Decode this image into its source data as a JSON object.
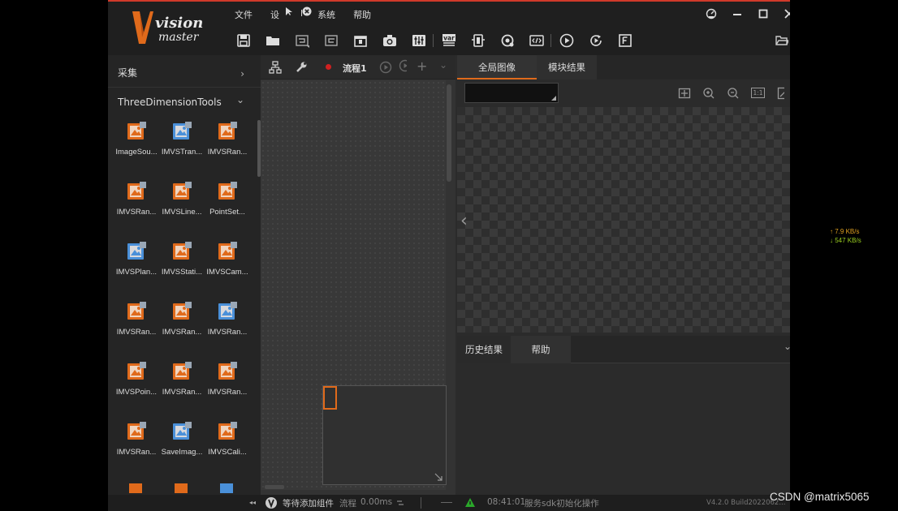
{
  "app": {
    "logo_word1": "vision",
    "logo_word2": "master",
    "brand_color": "#e06a1b",
    "accent_red": "#d03a2a"
  },
  "menu": [
    "文件",
    "设",
    "l",
    "系统",
    "帮助"
  ],
  "menu_icons": [
    "cursor-icon",
    "close-circle-icon"
  ],
  "window_controls": [
    "feedback-icon",
    "minimize-icon",
    "maximize-icon",
    "close-icon"
  ],
  "toolbar": [
    "save-icon",
    "open-folder-icon",
    "undo-icon",
    "redo-icon",
    "lock-icon",
    "camera-icon",
    "controller-settings-icon",
    "variable-icon",
    "device-icon",
    "communication-icon",
    "script-icon",
    "run-once-icon",
    "run-loop-icon",
    "format-icon"
  ],
  "left_panel": {
    "collect_label": "采集",
    "collect_arrow": "›",
    "group_label": "ThreeDimensionTools",
    "group_arrow": "⌄",
    "tools": [
      "ImageSou...",
      "IMVSTran...",
      "IMVSRan...",
      "IMVSRan...",
      "IMVSLine...",
      "PointSet...",
      "IMVSPlan...",
      "IMVSStati...",
      "IMVSCam...",
      "IMVSRan...",
      "IMVSRan...",
      "IMVSRan...",
      "IMVSPoin...",
      "IMVSRan...",
      "IMVSRan...",
      "IMVSRan...",
      "SaveImag...",
      "IMVSCali..."
    ],
    "collapse_glyph": "◂◂"
  },
  "flow_panel": {
    "tab_label": "流程1",
    "add_glyph": "+",
    "more_glyph": "⌄"
  },
  "image_panel": {
    "tabs": [
      "全局图像",
      "模块结果"
    ],
    "active_tab": 0,
    "zoom_fit_label": "1:1",
    "prev_glyph": "‹"
  },
  "history_panel": {
    "tabs": [
      "历史结果",
      "帮助"
    ],
    "more_glyph": "⌄"
  },
  "status": {
    "waiting": "等待添加组件",
    "flow_label": "流程",
    "flow_time": "0.00ms",
    "time": "08:41:01",
    "message": "服务sdk初始化操作",
    "version": "V4.2.0 Build2022062..."
  },
  "network": {
    "up": "↑ 7.9 KB/s",
    "down": "↓ 547 KB/s",
    "up_color": "#e0a020",
    "down_color": "#9bd020"
  },
  "watermark": "CSDN @matrix5065"
}
